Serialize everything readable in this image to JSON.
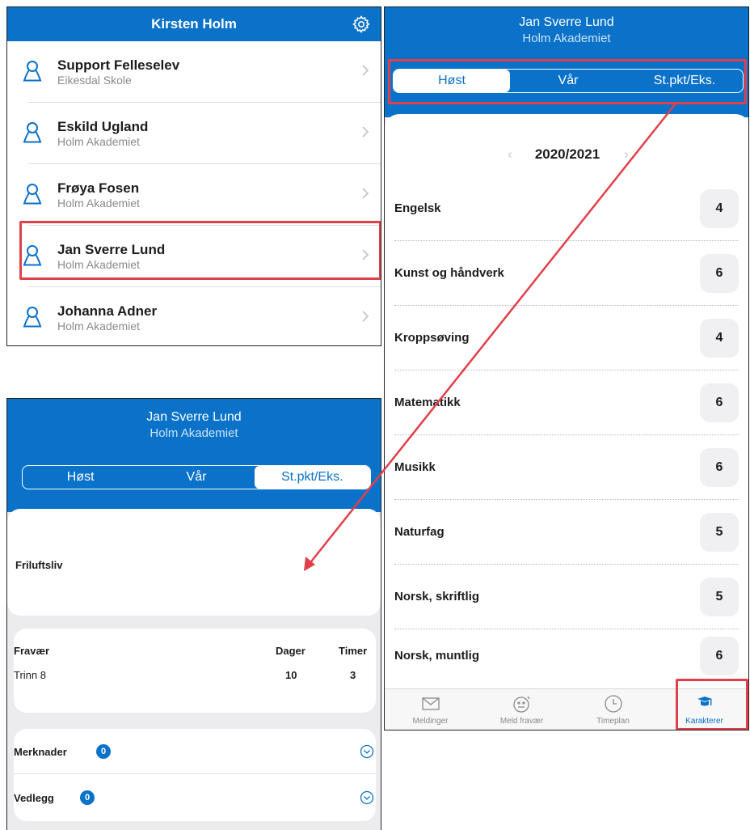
{
  "panel_a": {
    "title": "Kirsten Holm",
    "students": [
      {
        "name": "Support Felleselev",
        "school": "Eikesdal Skole"
      },
      {
        "name": "Eskild Ugland",
        "school": "Holm Akademiet"
      },
      {
        "name": "Frøya Fosen",
        "school": "Holm Akademiet"
      },
      {
        "name": "Jan Sverre Lund",
        "school": "Holm Akademiet"
      },
      {
        "name": "Johanna Adner",
        "school": "Holm Akademiet"
      }
    ]
  },
  "panel_b": {
    "student": "Jan Sverre Lund",
    "school": "Holm Akademiet",
    "segments": [
      "Høst",
      "Vår",
      "St.pkt/Eks."
    ],
    "year": "2020/2021",
    "grades": [
      {
        "subject": "Engelsk",
        "grade": "4"
      },
      {
        "subject": "Kunst og håndverk",
        "grade": "6"
      },
      {
        "subject": "Kroppsøving",
        "grade": "4"
      },
      {
        "subject": "Matematikk",
        "grade": "6"
      },
      {
        "subject": "Musikk",
        "grade": "6"
      },
      {
        "subject": "Naturfag",
        "grade": "5"
      },
      {
        "subject": "Norsk, skriftlig",
        "grade": "5"
      },
      {
        "subject": "Norsk, muntlig",
        "grade": "6"
      }
    ],
    "tabs": [
      "Meldinger",
      "Meld fravær",
      "Timeplan",
      "Karakterer"
    ]
  },
  "panel_c": {
    "student": "Jan Sverre Lund",
    "school": "Holm Akademiet",
    "segments": [
      "Høst",
      "Vår",
      "St.pkt/Eks."
    ],
    "subject": "Friluftsliv",
    "absence": {
      "title": "Fravær",
      "col_days": "Dager",
      "col_hours": "Timer",
      "row_label": "Trinn 8",
      "days": "10",
      "hours": "3"
    },
    "notes_label": "Merknader",
    "notes_count": "0",
    "attachments_label": "Vedlegg",
    "attachments_count": "0"
  },
  "colors": {
    "brand": "#0a72c9",
    "highlight": "#e0404a"
  }
}
